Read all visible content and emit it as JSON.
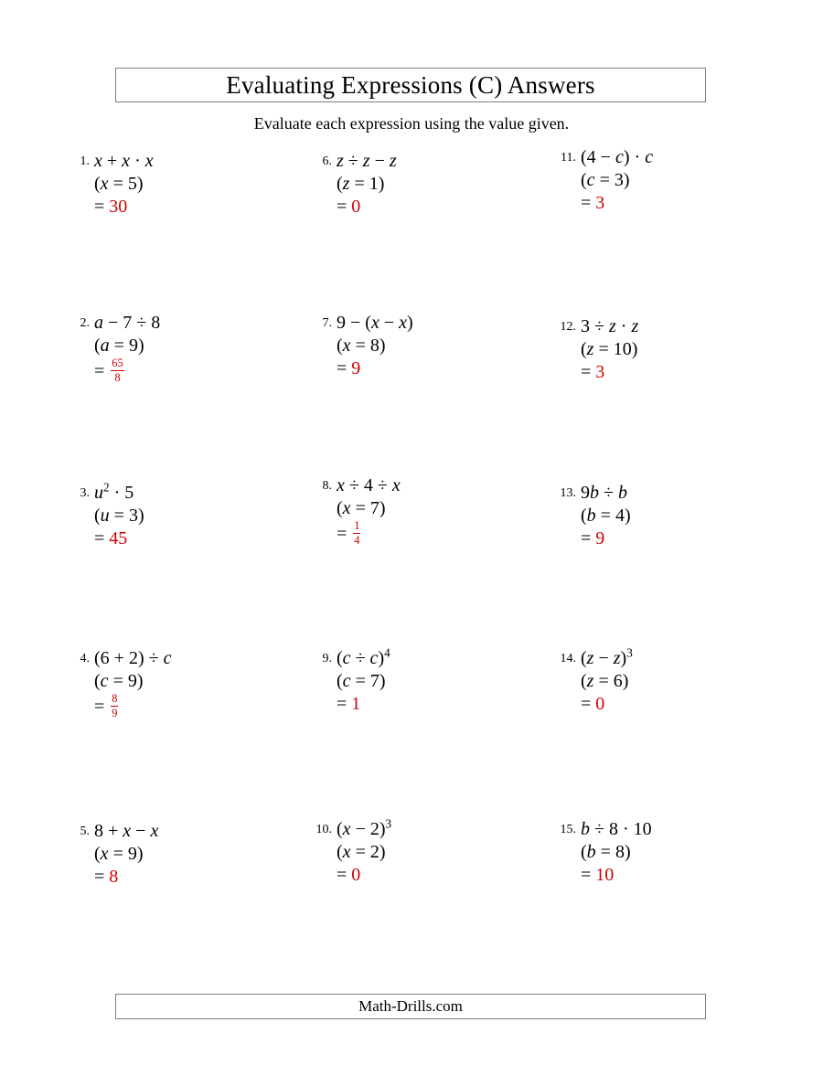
{
  "header": {
    "title": "Evaluating Expressions (C) Answers",
    "instructions": "Evaluate each expression using the value given."
  },
  "footer": {
    "text": "Math-Drills.com"
  },
  "colors": {
    "answer": "#CC0000",
    "text": "#000000",
    "border": "#808080",
    "background": "#FFFFFF"
  },
  "problems": [
    {
      "number": "1.",
      "expression": "x + x · x",
      "substitution": "(x = 5)",
      "answer_prefix": "=",
      "answer": "30",
      "answer_type": "integer",
      "column": 0,
      "row": 0
    },
    {
      "number": "2.",
      "expression": "a − 7 ÷ 8",
      "substitution": "(a = 9)",
      "answer_prefix": "=",
      "answer": "65/8",
      "answer_type": "fraction",
      "numerator": "65",
      "denominator": "8",
      "column": 0,
      "row": 1
    },
    {
      "number": "3.",
      "expression": "u² · 5",
      "substitution": "(u = 3)",
      "answer_prefix": "=",
      "answer": "45",
      "answer_type": "integer",
      "column": 0,
      "row": 2
    },
    {
      "number": "4.",
      "expression": "(6 + 2) ÷ c",
      "substitution": "(c = 9)",
      "answer_prefix": "=",
      "answer": "8/9",
      "answer_type": "fraction",
      "numerator": "8",
      "denominator": "9",
      "column": 0,
      "row": 3
    },
    {
      "number": "5.",
      "expression": "8 + x − x",
      "substitution": "(x = 9)",
      "answer_prefix": "=",
      "answer": "8",
      "answer_type": "integer",
      "column": 0,
      "row": 4
    },
    {
      "number": "6.",
      "expression": "z ÷ z − z",
      "substitution": "(z = 1)",
      "answer_prefix": "=",
      "answer": "0",
      "answer_type": "integer",
      "column": 1,
      "row": 0
    },
    {
      "number": "7.",
      "expression": "9 − (x − x)",
      "substitution": "(x = 8)",
      "answer_prefix": "=",
      "answer": "9",
      "answer_type": "integer",
      "column": 1,
      "row": 1
    },
    {
      "number": "8.",
      "expression": "x ÷ 4 ÷ x",
      "substitution": "(x = 7)",
      "answer_prefix": "=",
      "answer": "1/4",
      "answer_type": "fraction",
      "numerator": "1",
      "denominator": "4",
      "column": 1,
      "row": 2
    },
    {
      "number": "9.",
      "expression": "(c ÷ c)⁴",
      "substitution": "(c = 7)",
      "answer_prefix": "=",
      "answer": "1",
      "answer_type": "integer",
      "column": 1,
      "row": 3
    },
    {
      "number": "10.",
      "expression": "(x − 2)³",
      "substitution": "(x = 2)",
      "answer_prefix": "=",
      "answer": "0",
      "answer_type": "integer",
      "column": 1,
      "row": 4
    },
    {
      "number": "11.",
      "expression": "(4 − c) · c",
      "substitution": "(c = 3)",
      "answer_prefix": "=",
      "answer": "3",
      "answer_type": "integer",
      "column": 2,
      "row": 0
    },
    {
      "number": "12.",
      "expression": "3 ÷ z · z",
      "substitution": "(z = 10)",
      "answer_prefix": "=",
      "answer": "3",
      "answer_type": "integer",
      "column": 2,
      "row": 1
    },
    {
      "number": "13.",
      "expression": "9b ÷ b",
      "substitution": "(b = 4)",
      "answer_prefix": "=",
      "answer": "9",
      "answer_type": "integer",
      "column": 2,
      "row": 2
    },
    {
      "number": "14.",
      "expression": "(z − z)³",
      "substitution": "(z = 6)",
      "answer_prefix": "=",
      "answer": "0",
      "answer_type": "integer",
      "column": 2,
      "row": 3
    },
    {
      "number": "15.",
      "expression": "b ÷ 8 · 10",
      "substitution": "(b = 8)",
      "answer_prefix": "=",
      "answer": "10",
      "answer_type": "integer",
      "column": 2,
      "row": 4
    }
  ],
  "layout": {
    "column_lefts": [
      68,
      333,
      600
    ],
    "row_tops": [
      164,
      341,
      527,
      708,
      897
    ],
    "row_tops_col2": [
      164,
      341,
      519,
      708,
      895
    ],
    "row_tops_col3": [
      160,
      345,
      527,
      708,
      895
    ]
  }
}
